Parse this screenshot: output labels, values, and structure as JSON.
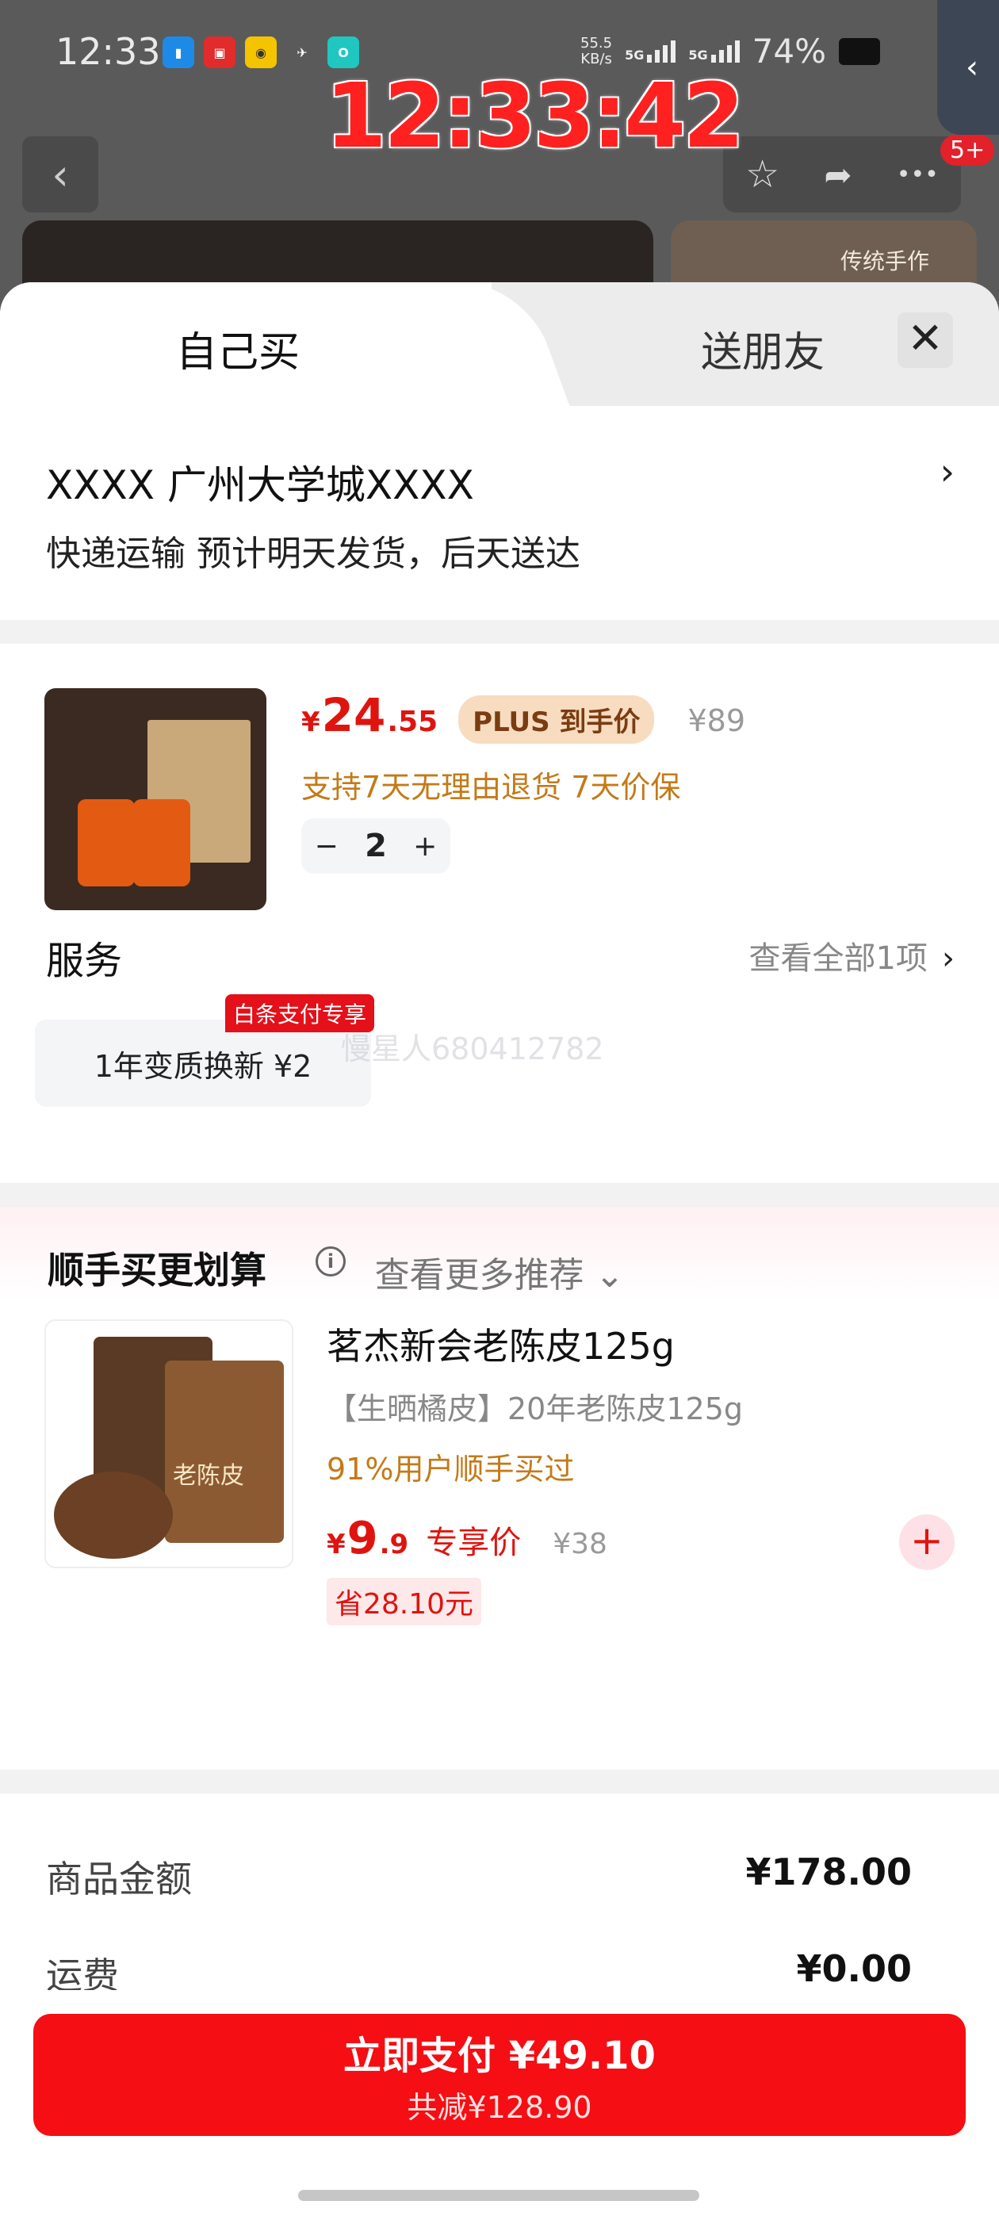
{
  "status": {
    "time": "12:33",
    "net_speed_value": "55.5",
    "net_speed_unit": "KB/s",
    "signal1": "5G",
    "signal2": "5G",
    "battery": "74%"
  },
  "clock_overlay": "12:33:42",
  "top_nav": {
    "back_icon": "‹",
    "star_icon": "☆",
    "share_icon": "➦",
    "more_icon": "•••",
    "badge": "5+",
    "hero_label": "传统手作"
  },
  "tabs": {
    "self_buy": "自己买",
    "gift": "送朋友",
    "close": "✕"
  },
  "address": {
    "line": "XXXX  广州大学城XXXX",
    "arrow": "›",
    "delivery": "快递运输 预计明天发货，后天送达"
  },
  "product": {
    "price_symbol": "¥",
    "price_int": "24",
    "price_dec": ".55",
    "plus_tag": "PLUS 到手价",
    "original_price": "¥89",
    "policy": "支持7天无理由退货  7天价保",
    "qty_minus": "−",
    "qty": "2",
    "qty_plus": "+"
  },
  "service": {
    "title": "服务",
    "view_all": "查看全部1项",
    "chevron": "›",
    "card_label": "1年变质换新  ¥2",
    "card_tag": "白条支付专享",
    "watermark": "慢星人680412782"
  },
  "recommend": {
    "title": "顺手买更划算",
    "info_icon": "i",
    "image_label": "老陈皮",
    "name": "茗杰新会老陈皮125g",
    "subtitle": "【生晒橘皮】20年老陈皮125g",
    "bought": "91%用户顺手买过",
    "price_symbol": "¥",
    "price_int": "9",
    "price_dec": ".9",
    "price_label": "专享价",
    "original_price": "¥38",
    "save": "省28.10元",
    "add": "+",
    "more": "查看更多推荐 ⌄"
  },
  "summary": {
    "goods_label": "商品金额",
    "goods_value": "¥178.00",
    "shipping_label": "运费",
    "shipping_value": "¥0.00"
  },
  "pay": {
    "main": "立即支付  ¥49.10",
    "sub": "共减¥128.90"
  },
  "colors": {
    "accent_red": "#f50e14",
    "price_red": "#e0140f",
    "policy_orange": "#c47a18"
  }
}
